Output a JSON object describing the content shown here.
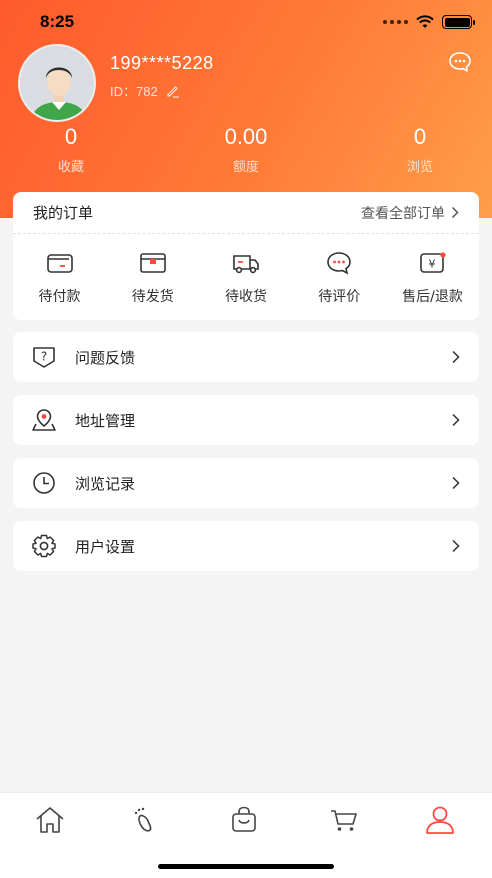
{
  "status_bar": {
    "time": "8:25"
  },
  "profile": {
    "username": "199****5228",
    "id_label": "ID：782",
    "icons": {
      "avatar": "avatar-person",
      "edit": "pencil-icon",
      "message": "chat-bubble-icon"
    }
  },
  "stats": [
    {
      "value": "0",
      "label": "收藏"
    },
    {
      "value": "0.00",
      "label": "额度"
    },
    {
      "value": "0",
      "label": "浏览"
    }
  ],
  "orders": {
    "title": "我的订单",
    "view_all": "查看全部订单",
    "items": [
      {
        "label": "待付款",
        "icon": "wallet-icon"
      },
      {
        "label": "待发货",
        "icon": "package-icon"
      },
      {
        "label": "待收货",
        "icon": "truck-icon"
      },
      {
        "label": "待评价",
        "icon": "chat-dots-icon"
      },
      {
        "label": "售后/退款",
        "icon": "yen-refund-icon"
      }
    ]
  },
  "menu": [
    {
      "label": "问题反馈",
      "icon": "question-shield-icon"
    },
    {
      "label": "地址管理",
      "icon": "location-pin-icon"
    },
    {
      "label": "浏览记录",
      "icon": "clock-icon"
    },
    {
      "label": "用户设置",
      "icon": "gear-icon"
    }
  ],
  "tabbar": {
    "tabs": [
      {
        "name": "home",
        "icon": "home-icon"
      },
      {
        "name": "category",
        "icon": "footprint-icon"
      },
      {
        "name": "shop",
        "icon": "bag-icon"
      },
      {
        "name": "cart",
        "icon": "cart-icon"
      },
      {
        "name": "mine",
        "icon": "user-icon",
        "active": true
      }
    ],
    "active_color": "#ff4a3d"
  },
  "colors": {
    "header_start": "#ff5a2c",
    "header_end": "#ff9e4a",
    "accent": "#ff4a3d"
  }
}
